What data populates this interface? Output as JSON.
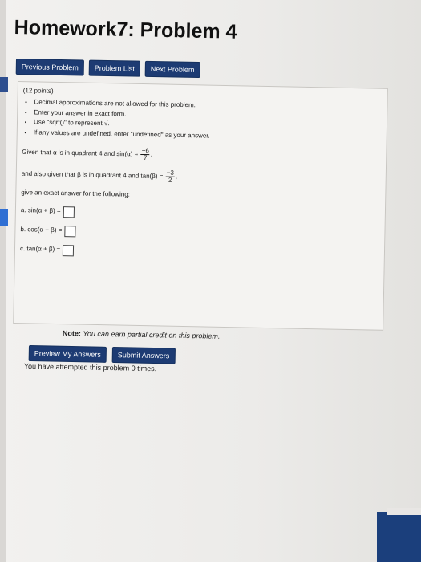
{
  "page": {
    "title": "Homework7: Problem 4",
    "nav": {
      "previous": "Previous Problem",
      "list": "Problem List",
      "next": "Next Problem"
    },
    "points": "(12 points)",
    "instructions": [
      "Decimal approximations are not allowed for this problem.",
      "Enter your answer in exact form.",
      "Use \"sqrt()\" to represent √.",
      "If any values are undefined, enter \"undefined\" as your answer."
    ],
    "given1_prefix": "Given that α is in quadrant 4 and sin(α) =",
    "given1_num": "−6",
    "given1_den": "7",
    "given2_prefix": "and also given that β is in quadrant 4 and tan(β) =",
    "given2_num": "−3",
    "given2_den": "2",
    "exact_prompt": "give an exact answer for the following:",
    "parts": [
      {
        "label": "a. sin(α + β) ="
      },
      {
        "label": "b. cos(α + β) ="
      },
      {
        "label": "c. tan(α + β) ="
      }
    ],
    "note_label": "Note:",
    "note_text": "You can earn partial credit on this problem.",
    "preview_button": "Preview My Answers",
    "submit_button": "Submit Answers",
    "attempts_text": "You have attempted this problem 0 times."
  }
}
